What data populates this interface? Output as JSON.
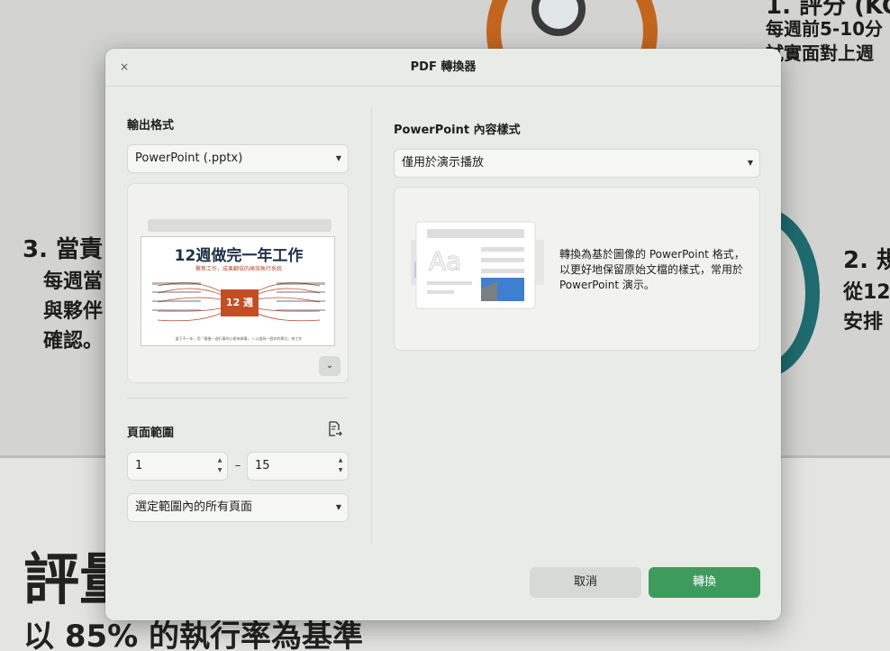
{
  "background": {
    "top_right_line1": "1. 評分 (KC",
    "top_right_line2": "每週前5-10分",
    "top_right_line3": "試實面對上週",
    "left_heading": "3. 當責",
    "left_line1": "每週當",
    "left_line2": "與夥伴",
    "left_line3": "確認。",
    "right_heading": "2. 規",
    "right_line1": "從12",
    "right_line2": "安排",
    "bottom_heading": "評量",
    "bottom_subheading": "以 85% 的執行率為基準"
  },
  "dialog": {
    "title": "PDF 轉換器",
    "close_glyph": "×",
    "output_format": {
      "label": "輸出格式",
      "selected": "PowerPoint (.pptx)"
    },
    "preview": {
      "slide_title": "12週做完一年工作",
      "slide_subtitle": "聚焦工作，成果翻倍的高效執行系統",
      "slide_center": "12 週",
      "slide_footer": "當下不一年，用「最後一週行事的心態來做事」→ 以週為一個年的單位，來工作"
    },
    "page_range": {
      "label": "頁面範圍",
      "from": "1",
      "separator": "–",
      "to": "15",
      "subset_selected": "選定範圍內的所有頁面"
    },
    "content_style": {
      "label": "PowerPoint 內容樣式",
      "selected": "僅用於演示播放",
      "description": "轉換為基於圖像的 PowerPoint 格式，以更好地保留原始文檔的樣式，常用於 PowerPoint 演示。",
      "illustration_text": "Aa"
    },
    "buttons": {
      "cancel": "取消",
      "convert": "轉換"
    }
  },
  "colors": {
    "accent_green": "#3d9b5e",
    "dialog_bg": "#e9ebe6",
    "brand_red": "#c24e25"
  }
}
